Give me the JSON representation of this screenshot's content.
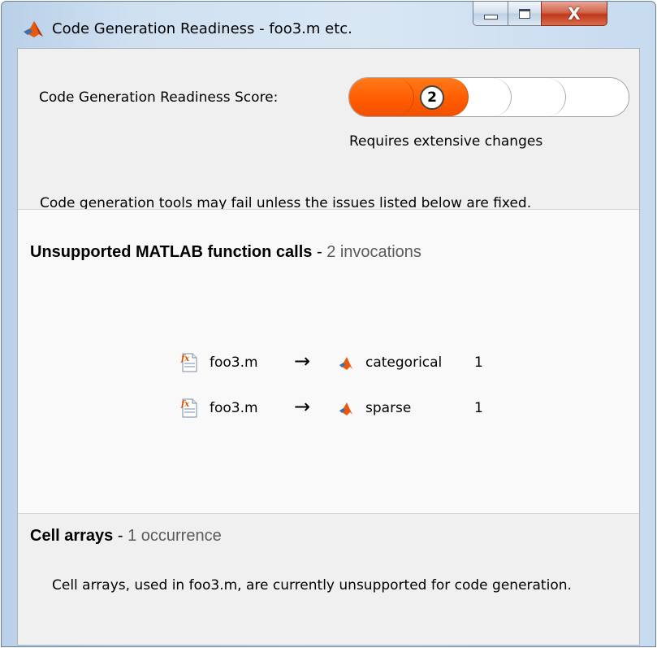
{
  "window": {
    "title": "Code Generation Readiness - foo3.m etc.",
    "app_icon": "matlab-icon",
    "controls": {
      "minimize_icon": "minimize-icon",
      "maximize_icon": "maximize-icon",
      "close_label": "X"
    }
  },
  "score": {
    "label": "Code Generation Readiness Score:",
    "value": "2",
    "max": 5,
    "description": "Requires extensive changes",
    "active_color": "#ff5a00"
  },
  "warning": "Code generation tools may fail unless the issues listed below are fixed.",
  "unsupported_calls": {
    "title": "Unsupported MATLAB function calls",
    "separator": " - ",
    "count_text": "2 invocations",
    "rows": [
      {
        "file": "foo3.m",
        "arrow": "→",
        "function": "categorical",
        "count": "1"
      },
      {
        "file": "foo3.m",
        "arrow": "→",
        "function": "sparse",
        "count": "1"
      }
    ]
  },
  "cell_arrays": {
    "title": "Cell arrays",
    "separator": " - ",
    "count_text": "1 occurrence",
    "description": "Cell arrays, used in foo3.m, are currently unsupported for code generation."
  }
}
